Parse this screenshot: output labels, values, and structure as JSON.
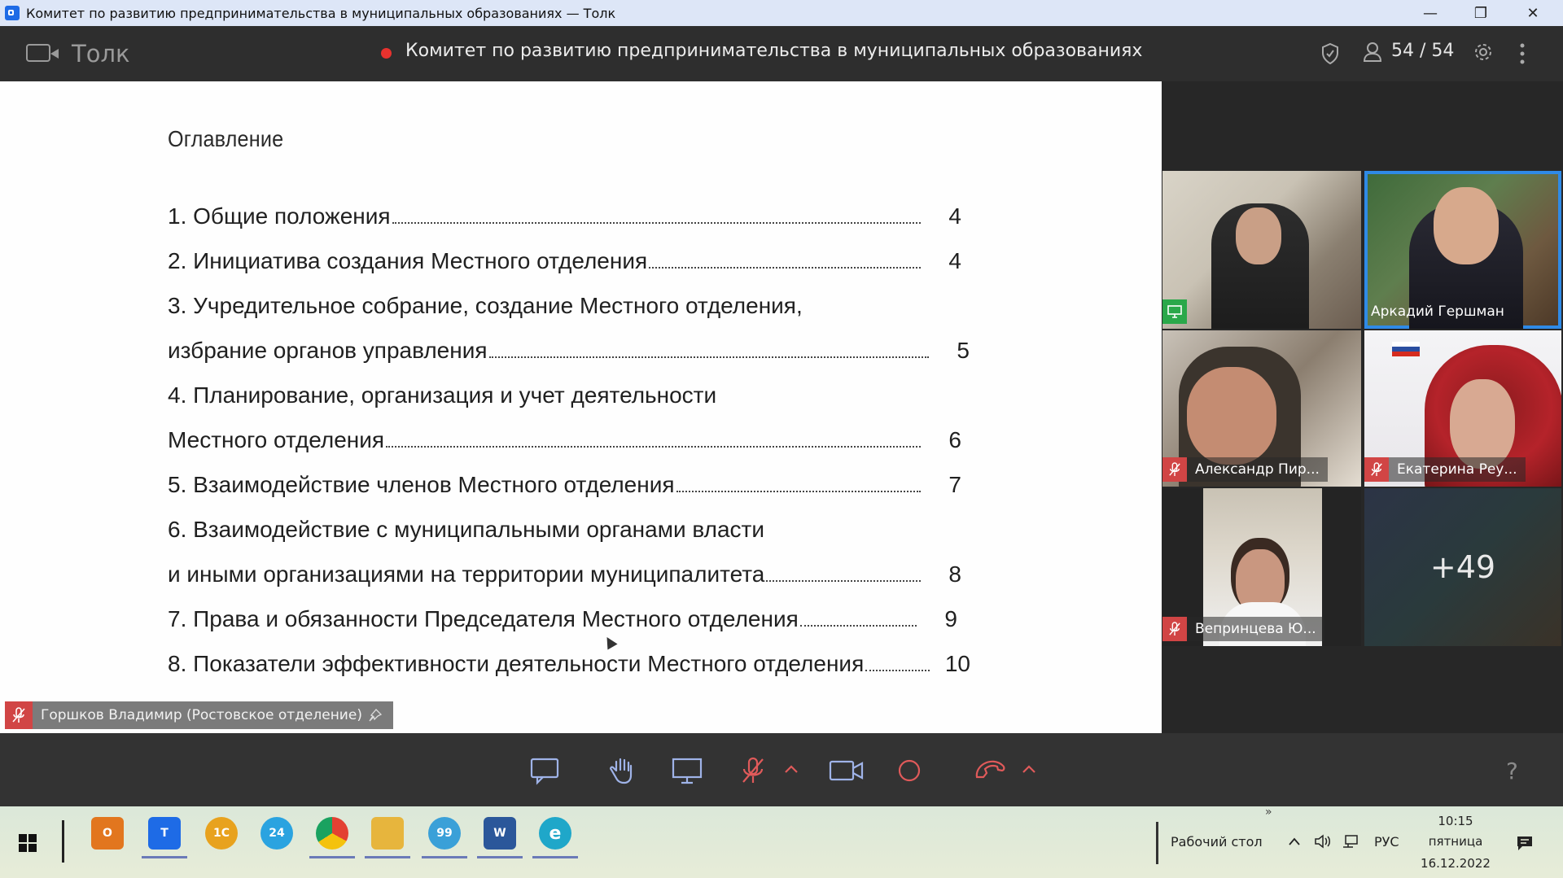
{
  "os_window": {
    "title": "Комитет по развитию предпринимательства в муниципальных образованиях — Толк",
    "minimize": "—",
    "restore": "❐",
    "close": "✕"
  },
  "header": {
    "app_name": "Толк",
    "conference_title": "Комитет по развитию предпринимательства в муниципальных образованиях",
    "participants_count": "54 / 54",
    "recording_color": "#e8322e"
  },
  "document": {
    "heading": "Оглавление",
    "toc": [
      {
        "text": "1. Общие положения",
        "page": "4"
      },
      {
        "text": "2. Инициатива создания Местного отделения",
        "page": "4"
      },
      {
        "text": "3. Учредительное собрание, создание Местного отделения,",
        "page": ""
      },
      {
        "text": "избрание органов управления",
        "page": "5"
      },
      {
        "text": "4. Планирование, организация и учет деятельности",
        "page": ""
      },
      {
        "text": "Местного отделения",
        "page": "6"
      },
      {
        "text": "5. Взаимодействие членов Местного отделения",
        "page": "7"
      },
      {
        "text": "6. Взаимодействие с муниципальными органами власти",
        "page": ""
      },
      {
        "text": "и иными организациями на территории муниципалитета",
        "page": "8"
      },
      {
        "text": "7. Права и обязанности Председателя Местного отделения",
        "page": "9"
      },
      {
        "text": "8. Показатели эффективности деятельности Местного отделения",
        "page": "10"
      }
    ],
    "speaker": "Горшков Владимир (Ростовское отделение)"
  },
  "participants": [
    {
      "name": "",
      "icon": "screen-share-icon"
    },
    {
      "name": "Аркадий Гершман",
      "icon": ""
    },
    {
      "name": "Александр Пир...",
      "icon": "mic-off-icon"
    },
    {
      "name": "Екатерина Реу...",
      "icon": "mic-off-icon"
    },
    {
      "name": "Веприн­цева Ю...",
      "icon": "mic-off-icon"
    },
    {
      "name": "+49",
      "icon": ""
    }
  ],
  "toolbar": {
    "help": "?"
  },
  "taskbar": {
    "apps": [
      {
        "label": "O",
        "color": "#e2761e"
      },
      {
        "label": "T",
        "color": "#1e6be6"
      },
      {
        "label": "1С",
        "color": "#e8a21e"
      },
      {
        "label": "24",
        "color": "#2aa3e0"
      },
      {
        "label": "",
        "color": "#e34133"
      },
      {
        "label": "",
        "color": "#e7b53d"
      },
      {
        "label": "99",
        "color": "#3aa0d8"
      },
      {
        "label": "W",
        "color": "#2b579a"
      },
      {
        "label": "e",
        "color": "#1fa7c9"
      }
    ],
    "desktop_label": "Рабочий стол",
    "language": "РУС",
    "time": "10:15",
    "weekday": "пятница",
    "date": "16.12.2022"
  }
}
